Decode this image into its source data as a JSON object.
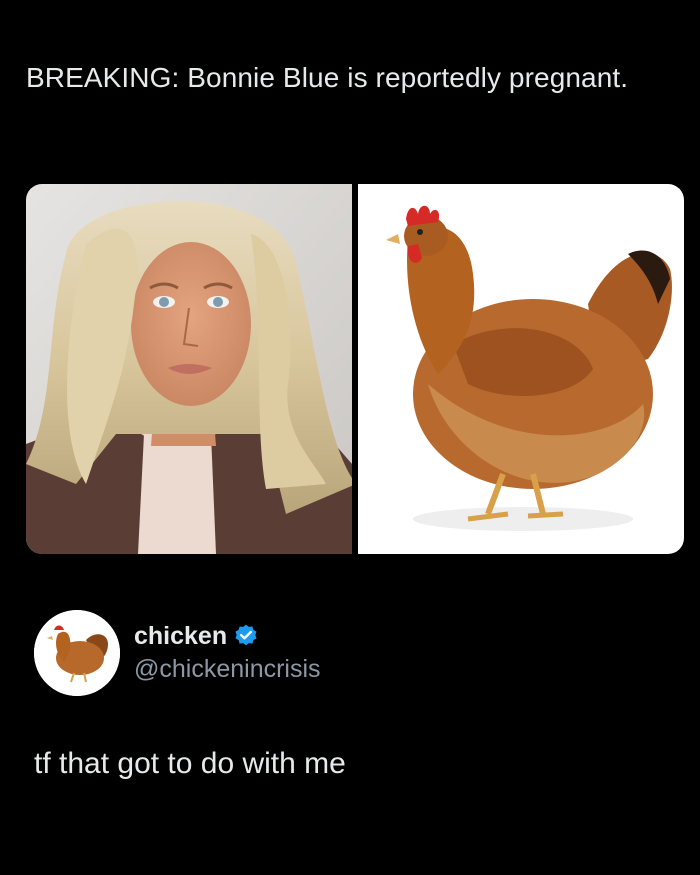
{
  "headline": "BREAKING: Bonnie Blue is reportedly pregnant.",
  "images": [
    {
      "icon": "woman-portrait-photo"
    },
    {
      "icon": "chicken-photo"
    }
  ],
  "reply": {
    "display_name": "chicken",
    "handle": "@chickenincrisis",
    "verified": true,
    "avatar_icon": "chicken-avatar",
    "text": "tf that got to do with me"
  },
  "colors": {
    "background": "#000000",
    "text": "#e7e9ea",
    "secondary_text": "#8b98a5",
    "verified_badge": "#1d9bf0"
  }
}
